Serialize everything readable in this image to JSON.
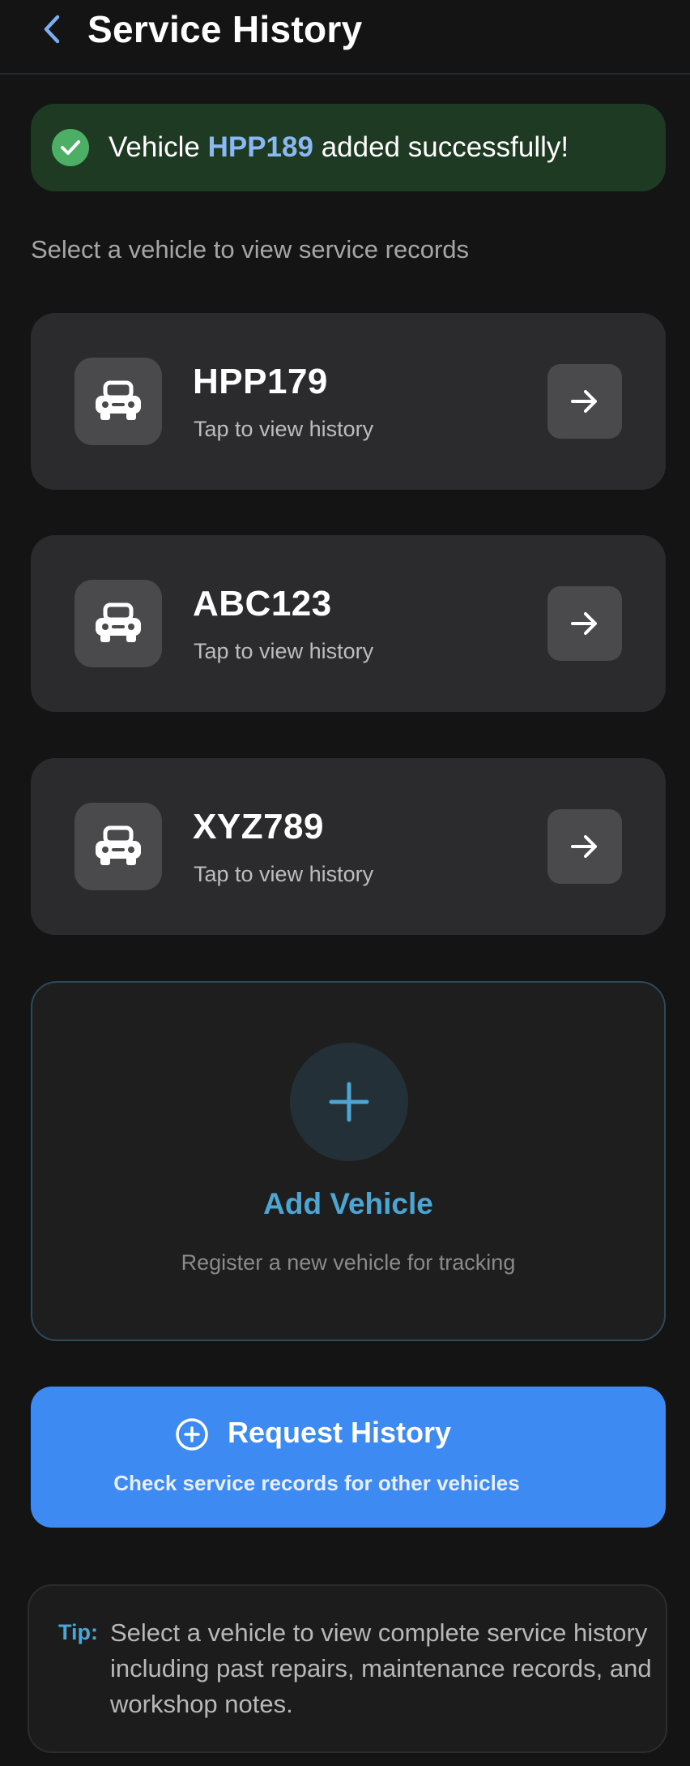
{
  "header": {
    "title": "Service History",
    "back_icon": "chevron-left-icon"
  },
  "banner": {
    "prefix": "Vehicle ",
    "plate": "HPP189",
    "suffix": " added successfully!",
    "icon": "check-circle-icon",
    "color": "#1e3a23"
  },
  "subtitle": "Select a vehicle to view service records",
  "vehicles": [
    {
      "plate": "HPP179",
      "hint": "Tap to view history",
      "icon": "car-icon",
      "action_icon": "arrow-right-icon"
    },
    {
      "plate": "ABC123",
      "hint": "Tap to view history",
      "icon": "car-icon",
      "action_icon": "arrow-right-icon"
    },
    {
      "plate": "XYZ789",
      "hint": "Tap to view history",
      "icon": "car-icon",
      "action_icon": "arrow-right-icon"
    }
  ],
  "add_vehicle": {
    "title": "Add Vehicle",
    "subtitle": "Register a new vehicle for tracking",
    "icon": "plus-icon",
    "accent": "#4da5d4"
  },
  "request_history": {
    "title": "Request History",
    "subtitle": "Check service records for other vehicles",
    "icon": "plus-circle-icon",
    "color": "#3d8af2"
  },
  "tip": {
    "label": "Tip:",
    "text": "Select a vehicle to view complete service history including past repairs, maintenance records, and workshop notes."
  }
}
